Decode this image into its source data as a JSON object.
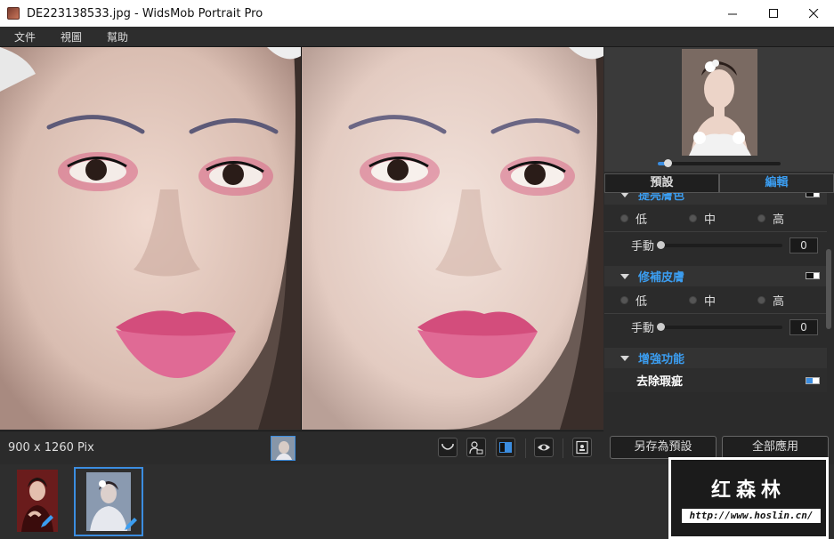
{
  "window": {
    "title": "DE223138533.jpg - WidsMob Portrait Pro",
    "minimize_icon": "minimize-icon",
    "maximize_icon": "maximize-icon",
    "close_icon": "close-icon"
  },
  "menu": [
    "文件",
    "視圖",
    "幫助"
  ],
  "panel": {
    "tabs": [
      {
        "label": "預設",
        "active": false
      },
      {
        "label": "編輯",
        "active": true
      }
    ],
    "zoom_level": 0.05,
    "sections": [
      {
        "title": "提亮膚色",
        "enabled": false,
        "options": [
          "低",
          "中",
          "高"
        ],
        "slider_label": "手動",
        "slider_value": "0"
      },
      {
        "title": "修補皮膚",
        "enabled": false,
        "options": [
          "低",
          "中",
          "高"
        ],
        "slider_label": "手動",
        "slider_value": "0"
      }
    ],
    "enhance": {
      "title": "增強功能",
      "items": [
        {
          "label": "去除瑕疵",
          "enabled": true
        }
      ]
    }
  },
  "status": {
    "dimensions": "900 x 1260 Pix",
    "icons": [
      "smile-icon",
      "person-lock-icon",
      "split-view-icon",
      "eye-icon",
      "portrait-frame-icon"
    ]
  },
  "actions": {
    "save_preset": "另存為預設",
    "apply_all": "全部應用"
  },
  "filmstrip": {
    "count": 2,
    "selected_index": 1
  },
  "watermark": {
    "title": "红森林",
    "url": "http://www.hoslin.cn/"
  },
  "colors": {
    "accent": "#3b8de0",
    "panel_bg": "#2b2b2b",
    "titlebar_bg": "#ffffff"
  }
}
